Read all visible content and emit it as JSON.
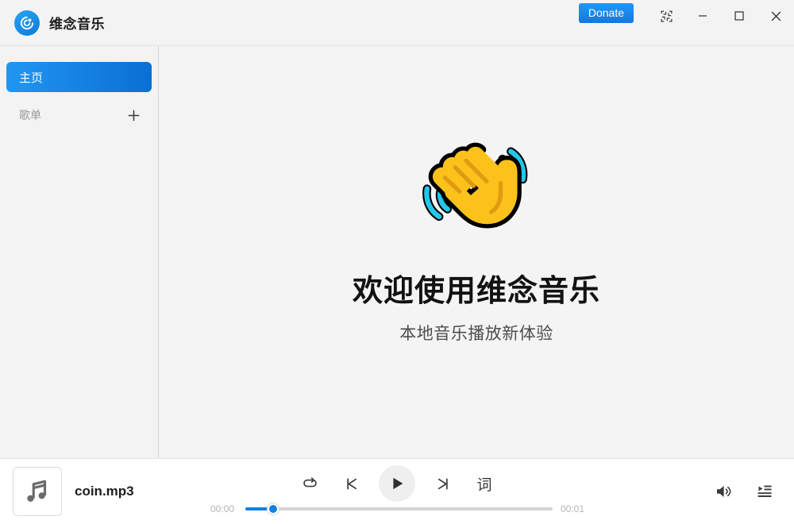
{
  "window": {
    "app_name": "维念音乐",
    "logo_icon": "disc-logo-icon",
    "accent_color": "#1380e0"
  },
  "titlebar": {
    "donate_label": "Donate",
    "collapse_icon": "collapse-arrows-icon",
    "minimize_icon": "minimize-icon",
    "maximize_icon": "maximize-icon",
    "close_icon": "close-icon"
  },
  "sidebar": {
    "items": [
      {
        "label": "主页",
        "active": true
      }
    ],
    "section": {
      "label": "歌单",
      "add_icon": "plus-icon"
    }
  },
  "main": {
    "emoji_icon": "waving-hand-emoji",
    "title": "欢迎使用维念音乐",
    "subtitle": "本地音乐播放新体验"
  },
  "player": {
    "cover_icon": "music-note-icon",
    "track_name": "coin.mp3",
    "controls": {
      "repeat_icon": "repeat-icon",
      "prev_icon": "previous-track-icon",
      "play_icon": "play-icon",
      "next_icon": "next-track-icon",
      "lyrics_label": "词"
    },
    "progress": {
      "current_time": "00:00",
      "total_time": "00:01",
      "percent": 9
    },
    "volume_icon": "volume-icon",
    "queue_icon": "playlist-queue-icon"
  }
}
